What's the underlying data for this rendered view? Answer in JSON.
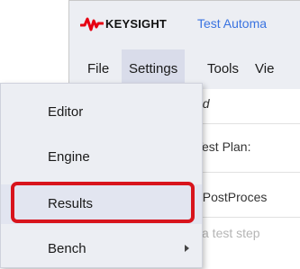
{
  "window": {
    "brand": "KEYSIGHT",
    "app_title": "Test Automa"
  },
  "menu_bar": {
    "items": [
      {
        "label": "File"
      },
      {
        "label": "Settings"
      },
      {
        "label": "Tools"
      },
      {
        "label": "Vie"
      }
    ],
    "active_index": 1
  },
  "content": {
    "line1": "ed",
    "line2": "Test Plan:",
    "line3": ": PostProces",
    "line4": "l a test step"
  },
  "dropdown": {
    "items": [
      {
        "label": "Editor",
        "has_submenu": false
      },
      {
        "label": "Engine",
        "has_submenu": false
      },
      {
        "label": "Results",
        "has_submenu": false
      },
      {
        "label": "Bench",
        "has_submenu": true
      }
    ],
    "highlighted_index": 2
  },
  "colors": {
    "accent_blue": "#3a73e0",
    "highlight_red": "#d8141c",
    "logo_red": "#e60012"
  }
}
